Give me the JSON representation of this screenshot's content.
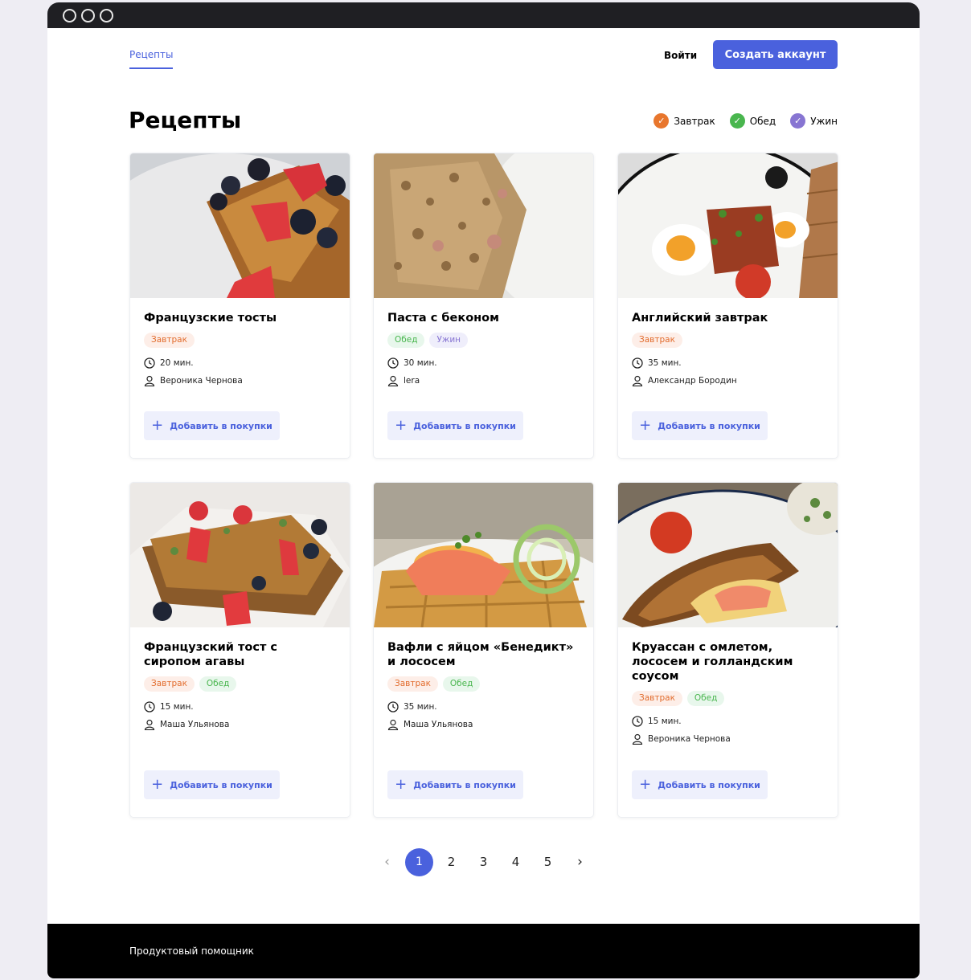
{
  "header": {
    "nav_link": "Рецепты",
    "login": "Войти",
    "signup": "Создать аккаунт"
  },
  "page_title": "Рецепты",
  "filters": [
    {
      "label": "Завтрак",
      "color": "#e8762d"
    },
    {
      "label": "Обед",
      "color": "#49b64e"
    },
    {
      "label": "Ужин",
      "color": "#8775d2"
    }
  ],
  "colors": {
    "accent": "#4a61dd",
    "tag_orange": "#e26c2d",
    "tag_green": "#49b64e",
    "tag_purple": "#8775d2"
  },
  "cards": [
    {
      "title": "Французские тосты",
      "tags": [
        "Завтрак"
      ],
      "time": "20 мин.",
      "author": "Вероника Чернова",
      "button": "Добавить в покупки"
    },
    {
      "title": "Паста с беконом",
      "tags": [
        "Обед",
        "Ужин"
      ],
      "time": "30 мин.",
      "author": "lera",
      "button": "Добавить в покупки"
    },
    {
      "title": "Английский завтрак",
      "tags": [
        "Завтрак"
      ],
      "time": "35 мин.",
      "author": "Александр Бородин",
      "button": "Добавить в покупки"
    },
    {
      "title": "Французский тост с сиропом агавы",
      "tags": [
        "Завтрак",
        "Обед"
      ],
      "time": "15 мин.",
      "author": "Маша Ульянова",
      "button": "Добавить в покупки"
    },
    {
      "title": "Вафли с яйцом «Бенедикт» и лососем",
      "tags": [
        "Завтрак",
        "Обед"
      ],
      "time": "35 мин.",
      "author": "Маша Ульянова",
      "button": "Добавить в покупки"
    },
    {
      "title": "Круассан с омлетом, лососем и голландским соусом",
      "tags": [
        "Завтрак",
        "Обед"
      ],
      "time": "15 мин.",
      "author": "Вероника Чернова",
      "button": "Добавить в покупки"
    }
  ],
  "pagination": {
    "prev": "‹",
    "pages": [
      "1",
      "2",
      "3",
      "4",
      "5"
    ],
    "current": "1",
    "next": "›"
  },
  "footer": {
    "text": "Продуктовый помощник"
  }
}
